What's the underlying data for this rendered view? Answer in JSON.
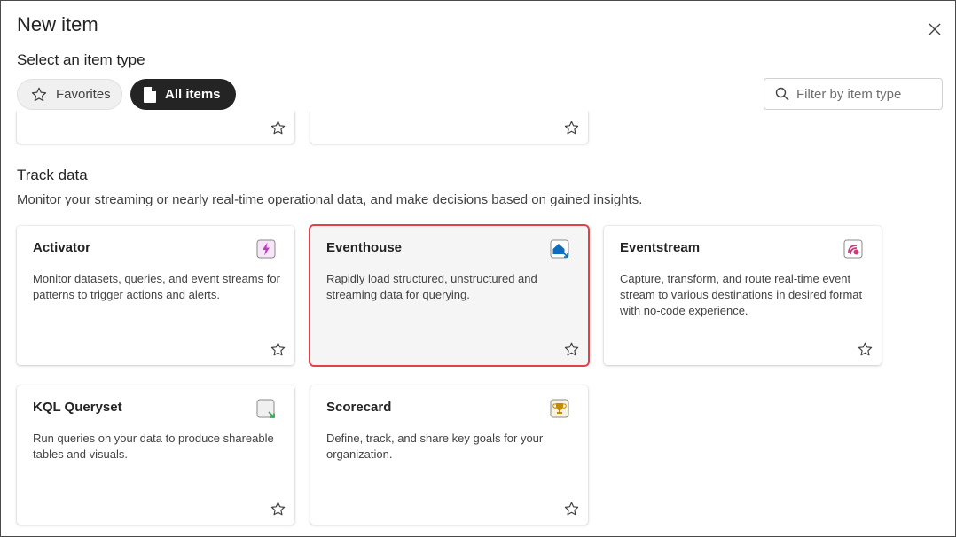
{
  "dialog": {
    "title": "New item",
    "subtitle": "Select an item type"
  },
  "filters": {
    "favorites_label": "Favorites",
    "all_items_label": "All items",
    "selected": "All items"
  },
  "search": {
    "placeholder": "Filter by item type",
    "value": ""
  },
  "section": {
    "title": "Track data",
    "description": "Monitor your streaming or nearly real-time operational data, and make decisions based on gained insights."
  },
  "items": [
    {
      "name": "Activator",
      "description": "Monitor datasets, queries, and event streams for patterns to trigger actions and alerts.",
      "icon": "activator-icon",
      "accent": "#c03bc4"
    },
    {
      "name": "Eventhouse",
      "description": "Rapidly load structured, unstructured and streaming data for querying.",
      "icon": "eventhouse-icon",
      "accent": "#0f6cbd"
    },
    {
      "name": "Eventstream",
      "description": "Capture, transform, and route real-time event stream to various destinations in desired format with no-code experience.",
      "icon": "eventstream-icon",
      "accent": "#d13a78"
    },
    {
      "name": "KQL Queryset",
      "description": "Run queries on your data to produce shareable tables and visuals.",
      "icon": "kql-queryset-icon",
      "accent": "#3aa852"
    },
    {
      "name": "Scorecard",
      "description": "Define, track, and share key goals for your organization.",
      "icon": "scorecard-icon",
      "accent": "#c68a00"
    }
  ],
  "highlight_color": "#e0424a"
}
